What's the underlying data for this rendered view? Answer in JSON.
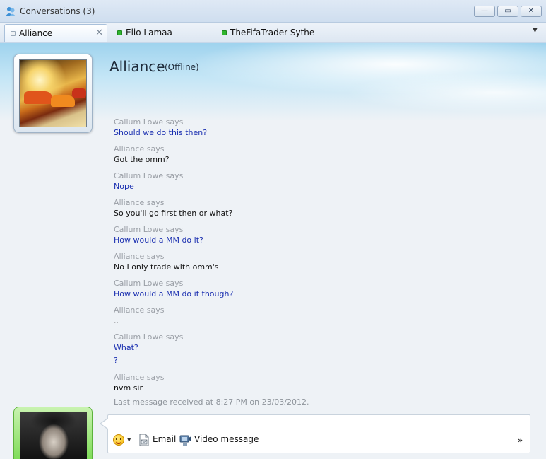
{
  "window": {
    "title": "Conversations (3)",
    "controls": {
      "minimize": "—",
      "restore": "▭",
      "close": "✕"
    }
  },
  "tabs": [
    {
      "label": "Alliance",
      "status": "offline",
      "active": true,
      "close": "✕"
    },
    {
      "label": "Elio Lamaa",
      "status": "online",
      "active": false
    },
    {
      "label": "TheFifaTrader Sythe",
      "status": "online",
      "active": false
    }
  ],
  "tab_menu_glyph": "▼",
  "contact": {
    "name": "Alliance",
    "status": "(Offline)"
  },
  "messages": [
    {
      "says": "Callum Lowe says",
      "text": "Should we do this then?",
      "mine": true
    },
    {
      "says": "Alliance says",
      "text": "Got the omm?",
      "mine": false
    },
    {
      "says": "Callum Lowe says",
      "text": "Nope",
      "mine": true
    },
    {
      "says": "Alliance says",
      "text": "So you'll go first then or what?",
      "mine": false
    },
    {
      "says": "Callum Lowe says",
      "text": "How would a MM do it?",
      "mine": true
    },
    {
      "says": "Alliance says",
      "text": "No I only trade with omm's",
      "mine": false
    },
    {
      "says": "Callum Lowe says",
      "text": "How would a MM do it though?",
      "mine": true
    },
    {
      "says": "Alliance says",
      "text": "..",
      "mine": false
    },
    {
      "says": "Callum Lowe says",
      "text": "What?",
      "mine": true
    },
    {
      "says": "",
      "text": "?",
      "mine": true
    },
    {
      "says": "Alliance says",
      "text": "nvm sir",
      "mine": false
    }
  ],
  "last_received": "Last message received at 8:27 PM on 23/03/2012.",
  "toolbar": {
    "emoticon_caret": "▼",
    "email_label": "Email",
    "video_label": "Video message",
    "more_glyph": "»"
  },
  "colors": {
    "mine_text": "#1a2fb0",
    "theirs_text": "#111111",
    "says_text": "#9a9fa6",
    "online": "#2fb52f"
  }
}
